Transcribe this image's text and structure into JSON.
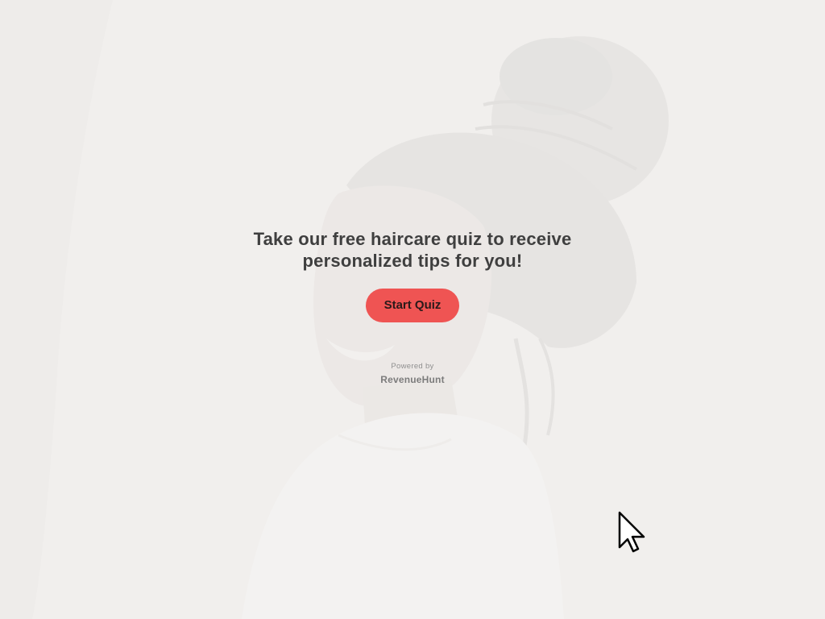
{
  "hero": {
    "headline_line1": "Take our free haircare quiz to receive",
    "headline_line2": "personalized tips for you!",
    "button_label": "Start Quiz",
    "background_image": "smiling-woman-braided-hair-photo",
    "accent_color": "#ef5453"
  },
  "footer": {
    "powered_by": "Powered by",
    "brand": "RevenueHunt"
  },
  "cursor": {
    "icon": "mouse-pointer-icon"
  }
}
